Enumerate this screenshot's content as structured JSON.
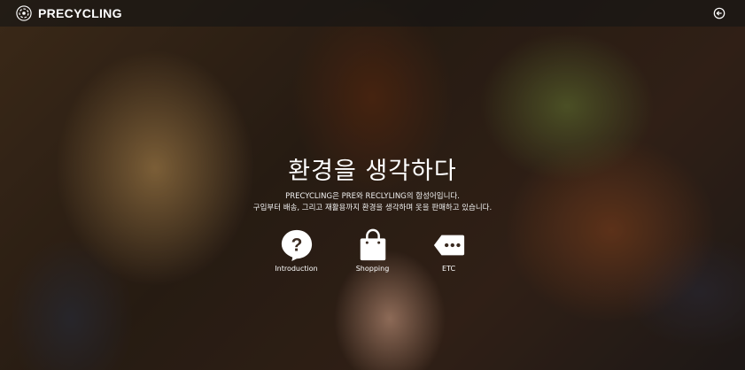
{
  "header": {
    "brand": "PRECYCLING",
    "logo_icon": "recycle-logo-icon",
    "logout_icon": "logout-icon"
  },
  "hero": {
    "title": "환경을 생각하다",
    "line1": "PRECYCLING은 PRE와 RECLYLING의 합성어입니다.",
    "line2": "구입부터 배송, 그리고 재활용까지 환경을 생각하며 옷을 판매하고 있습니다."
  },
  "menu": [
    {
      "label": "Introduction",
      "icon": "question-bubble-icon"
    },
    {
      "label": "Shopping",
      "icon": "shopping-bag-icon"
    },
    {
      "label": "ETC",
      "icon": "more-tag-icon"
    }
  ],
  "colors": {
    "text": "#ffffff",
    "header_bg": "#141414"
  }
}
